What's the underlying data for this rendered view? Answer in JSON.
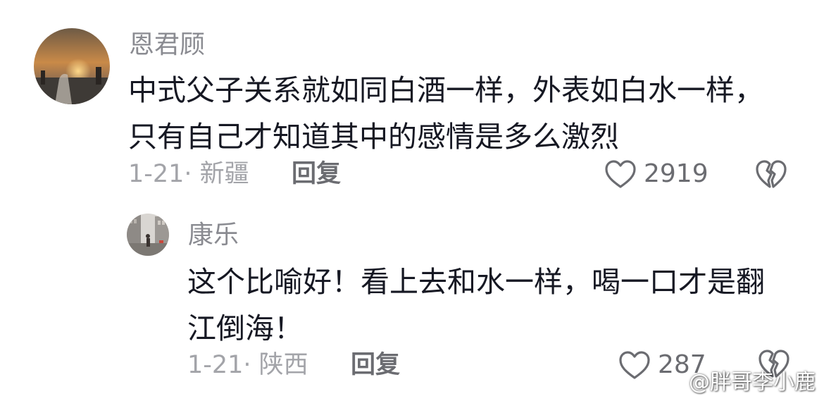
{
  "comment": {
    "username": "恩君顾",
    "text": "中式父子关系就如同白酒一样，外表如白水一样，只有自己才知道其中的感情是多么激烈",
    "date_location": "1-21· 新疆",
    "reply_label": "回复",
    "like_count": "2919"
  },
  "reply": {
    "username": "康乐",
    "text": "这个比喻好！看上去和水一样，喝一口才是翻江倒海！",
    "date_location": "1-21· 陕西",
    "reply_label": "回复",
    "like_count": "287"
  },
  "watermark": "@胖哥李小鹿",
  "colors": {
    "text": "#161823",
    "username": "#8a8b91",
    "meta": "#a3a4a9",
    "action": "#6b6c71"
  },
  "icons": [
    "heart-outline-icon",
    "broken-heart-icon",
    "weibo-logo-icon"
  ]
}
